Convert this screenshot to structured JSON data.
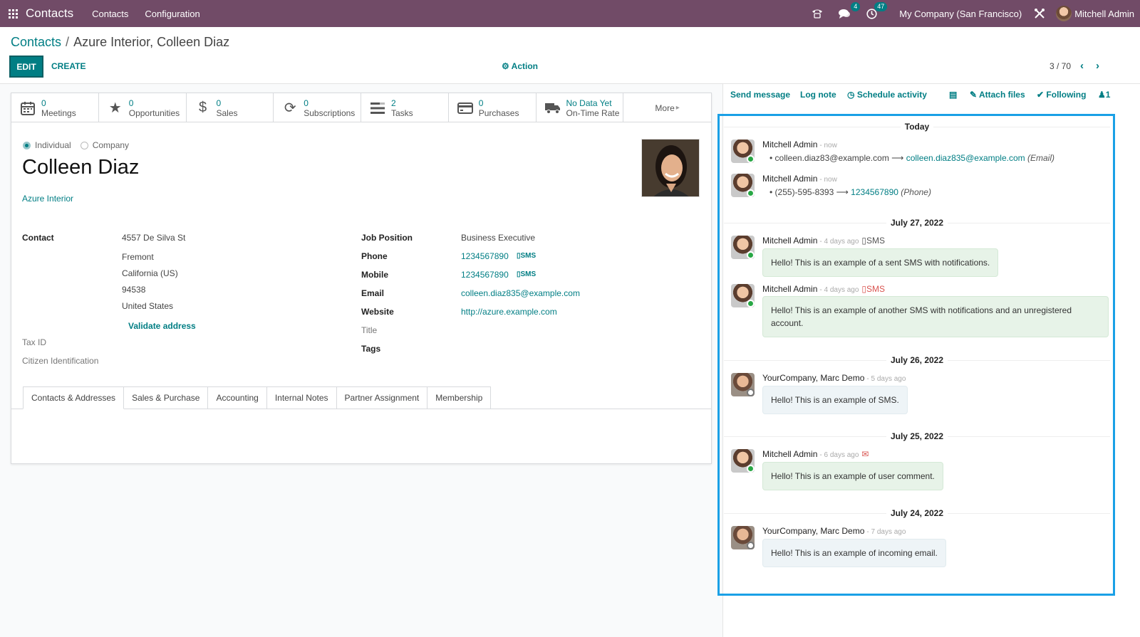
{
  "navbar": {
    "app_name": "Contacts",
    "menus": [
      "Contacts",
      "Configuration"
    ],
    "chat_count": "4",
    "activity_count": "47",
    "company": "My Company (San Francisco)",
    "user": "Mitchell Admin"
  },
  "breadcrumb": {
    "parent": "Contacts",
    "current": "Azure Interior, Colleen Diaz"
  },
  "toolbar": {
    "edit_label": "EDIT",
    "create_label": "CREATE",
    "action_label": "Action",
    "pager": "3 / 70"
  },
  "smart_buttons": [
    {
      "count": "0",
      "label": "Meetings",
      "icon": "calendar-icon"
    },
    {
      "count": "0",
      "label": "Opportunities",
      "icon": "star-icon"
    },
    {
      "count": "0",
      "label": "Sales",
      "icon": "dollar-icon"
    },
    {
      "count": "0",
      "label": "Subscriptions",
      "icon": "refresh-icon"
    },
    {
      "count": "2",
      "label": "Tasks",
      "icon": "tasks-icon"
    },
    {
      "count": "0",
      "label": "Purchases",
      "icon": "credit-card-icon"
    },
    {
      "count": "No Data Yet",
      "label": "On-Time Rate",
      "icon": "truck-icon"
    }
  ],
  "more_label": "More",
  "form": {
    "type_individual": "Individual",
    "type_company": "Company",
    "name": "Colleen Diaz",
    "parent": "Azure Interior",
    "contact_label": "Contact",
    "street": "4557 De Silva St",
    "city": "Fremont",
    "state": "California (US)",
    "zip": "94538",
    "country": "United States",
    "validate_label": "Validate address",
    "tax_id_label": "Tax ID",
    "citizen_label": "Citizen Identification",
    "job_label": "Job Position",
    "job_value": "Business Executive",
    "phone_label": "Phone",
    "phone_value": "1234567890",
    "mobile_label": "Mobile",
    "mobile_value": "1234567890",
    "sms_label": "SMS",
    "email_label": "Email",
    "email_value": "colleen.diaz835@example.com",
    "website_label": "Website",
    "website_value": "http://azure.example.com",
    "title_label": "Title",
    "tags_label": "Tags"
  },
  "tabs": [
    "Contacts & Addresses",
    "Sales & Purchase",
    "Accounting",
    "Internal Notes",
    "Partner Assignment",
    "Membership"
  ],
  "chatter": {
    "send_message": "Send message",
    "log_note": "Log note",
    "schedule_activity": "Schedule activity",
    "attach_files": "Attach files",
    "following": "Following",
    "followers": "1",
    "dates": [
      "Today",
      "July 27, 2022",
      "July 26, 2022",
      "July 25, 2022",
      "July 24, 2022"
    ],
    "messages": [
      {
        "author": "Mitchell Admin",
        "when": "- now",
        "old": "colleen.diaz83@example.com",
        "new": "colleen.diaz835@example.com",
        "field": "(Email)"
      },
      {
        "author": "Mitchell Admin",
        "when": "- now",
        "old": "(255)-595-8393",
        "new": "1234567890",
        "field": "(Phone)"
      },
      {
        "author": "Mitchell Admin",
        "when": "- 4 days ago",
        "tag": "SMS",
        "body": "Hello! This is an example of a sent SMS with notifications."
      },
      {
        "author": "Mitchell Admin",
        "when": "- 4 days ago",
        "tag": "SMS",
        "body": "Hello! This is an example of another SMS with notifications and an unregistered account."
      },
      {
        "author": "YourCompany, Marc Demo",
        "when": "- 5 days ago",
        "body": "Hello! This is an example of SMS."
      },
      {
        "author": "Mitchell Admin",
        "when": "- 6 days ago",
        "body": "Hello! This is an example of user comment."
      },
      {
        "author": "YourCompany, Marc Demo",
        "when": "- 7 days ago",
        "body": "Hello! This is an example of incoming email."
      }
    ]
  },
  "colors": {
    "brand": "#714b67",
    "accent": "#017e84",
    "highlight_frame": "#1aa0e6",
    "error": "#d9534f"
  }
}
